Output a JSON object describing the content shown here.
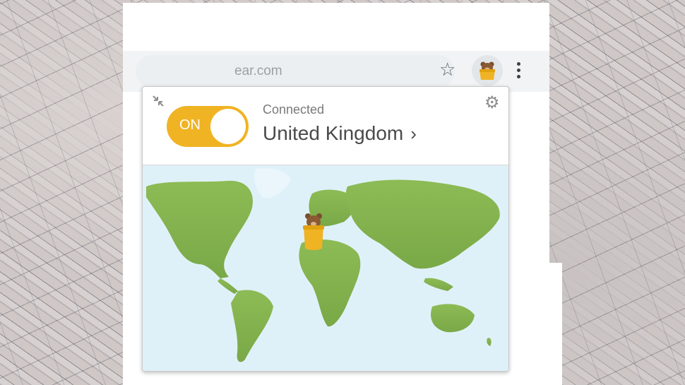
{
  "browser": {
    "url_fragment": "ear.com",
    "star_icon": "star-outline-icon",
    "extension_icon": "bear-icon",
    "menu_icon": "kebab-menu-icon"
  },
  "popup": {
    "toggle_label": "ON",
    "status": "Connected",
    "location": "United Kingdom",
    "location_chevron": "›",
    "settings_icon": "gear-icon",
    "collapse_icon": "collapse-arrows-icon",
    "accent_color": "#f0b323",
    "map_land_color": "#7fae4a",
    "map_water_color": "#dff1f8"
  }
}
